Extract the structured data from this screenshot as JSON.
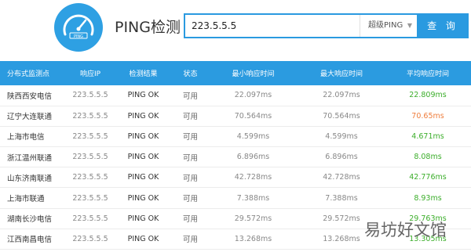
{
  "header": {
    "title": "PING检测",
    "search": {
      "value": "223.5.5.5"
    },
    "select": {
      "selected": "超级PING"
    },
    "search_button": "查 询"
  },
  "table": {
    "columns": [
      "分布式监测点",
      "响应IP",
      "检测结果",
      "状态",
      "最小响应时间",
      "最大响应时间",
      "平均响应时间"
    ],
    "rows": [
      {
        "node": "陕西西安电信",
        "ip": "223.5.5.5",
        "result": "PING OK",
        "state": "可用",
        "min": "22.097ms",
        "max": "22.097ms",
        "avg": "22.809ms",
        "avg_color": "green"
      },
      {
        "node": "辽宁大连联通",
        "ip": "223.5.5.5",
        "result": "PING OK",
        "state": "可用",
        "min": "70.564ms",
        "max": "70.564ms",
        "avg": "70.65ms",
        "avg_color": "orange"
      },
      {
        "node": "上海市电信",
        "ip": "223.5.5.5",
        "result": "PING OK",
        "state": "可用",
        "min": "4.599ms",
        "max": "4.599ms",
        "avg": "4.671ms",
        "avg_color": "green"
      },
      {
        "node": "浙江温州联通",
        "ip": "223.5.5.5",
        "result": "PING OK",
        "state": "可用",
        "min": "6.896ms",
        "max": "6.896ms",
        "avg": "8.08ms",
        "avg_color": "green"
      },
      {
        "node": "山东济南联通",
        "ip": "223.5.5.5",
        "result": "PING OK",
        "state": "可用",
        "min": "42.728ms",
        "max": "42.728ms",
        "avg": "42.776ms",
        "avg_color": "green"
      },
      {
        "node": "上海市联通",
        "ip": "223.5.5.5",
        "result": "PING OK",
        "state": "可用",
        "min": "7.388ms",
        "max": "7.388ms",
        "avg": "8.93ms",
        "avg_color": "green"
      },
      {
        "node": "湖南长沙电信",
        "ip": "223.5.5.5",
        "result": "PING OK",
        "state": "可用",
        "min": "29.572ms",
        "max": "29.572ms",
        "avg": "29.763ms",
        "avg_color": "green"
      },
      {
        "node": "江西南昌电信",
        "ip": "223.5.5.5",
        "result": "PING OK",
        "state": "可用",
        "min": "13.268ms",
        "max": "13.268ms",
        "avg": "13.305ms",
        "avg_color": "green"
      }
    ]
  },
  "watermark": "易坊好文馆",
  "colors": {
    "accent": "#2b9be0",
    "green": "#3cae2b",
    "orange": "#ef7e3d"
  },
  "icons": {
    "logo": "speedometer-icon",
    "select_chevron": "chevron-down-icon"
  }
}
